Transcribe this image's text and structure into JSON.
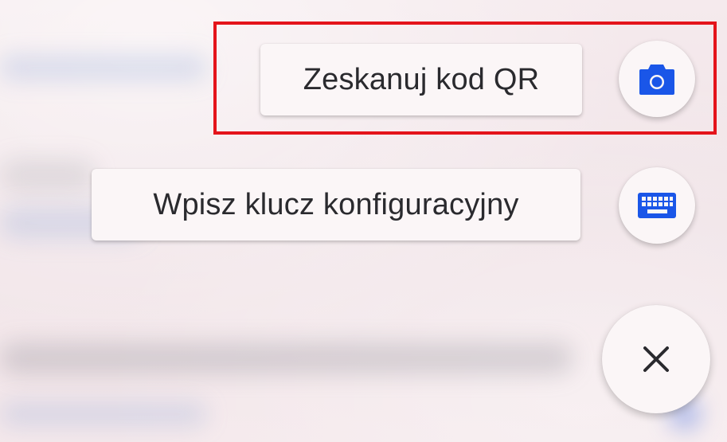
{
  "speed_dial": {
    "scan_qr": {
      "label": "Zeskanuj kod QR",
      "icon": "camera-icon"
    },
    "enter_key": {
      "label": "Wpisz klucz konfiguracyjny",
      "icon": "keyboard-icon"
    },
    "close": {
      "icon": "close-icon"
    }
  },
  "colors": {
    "accent": "#1a56e8",
    "highlight": "#e4141b",
    "surface": "#fbf6f7",
    "text": "#2a2a2e"
  }
}
